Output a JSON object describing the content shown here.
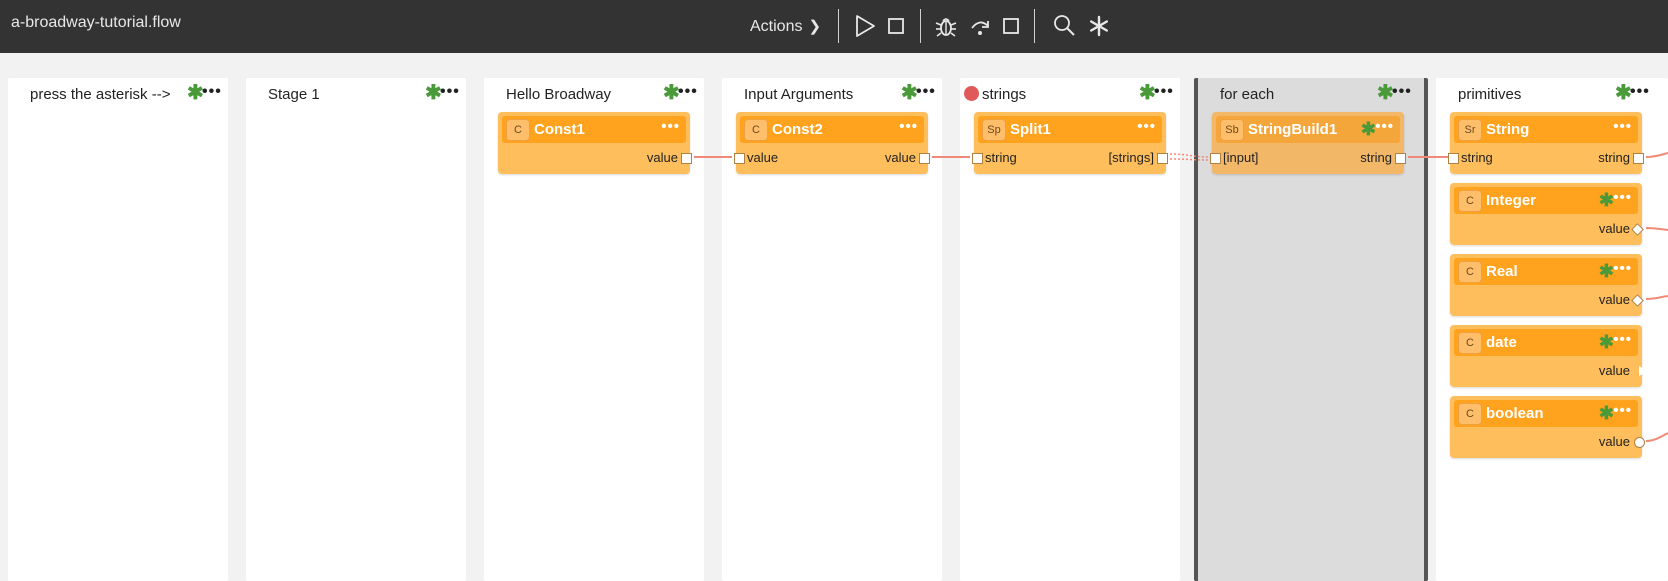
{
  "topbar": {
    "filename": "a-broadway-tutorial.flow",
    "actions_label": "Actions",
    "icons": [
      "play-icon",
      "stop-icon",
      "debug-bug-icon",
      "step-over-icon",
      "debug-stop-icon",
      "search-icon",
      "asterisk-icon"
    ]
  },
  "stages": [
    {
      "title": "press the asterisk -->"
    },
    {
      "title": "Stage 1"
    },
    {
      "title": "Hello Broadway"
    },
    {
      "title": "Input Arguments"
    },
    {
      "title": "strings"
    },
    {
      "title": "for each"
    },
    {
      "title": "primitives"
    }
  ],
  "nodes": [
    {
      "type": "C",
      "name": "Const1",
      "ports": {
        "out": "value"
      }
    },
    {
      "type": "C",
      "name": "Const2",
      "ports": {
        "in": "value",
        "out": "value"
      }
    },
    {
      "type": "Sp",
      "name": "Split1",
      "ports": {
        "in": "string",
        "out": "[strings]"
      }
    },
    {
      "type": "Sb",
      "name": "StringBuild1",
      "ports": {
        "in": "[input]",
        "out": "string"
      }
    },
    {
      "type": "Sr",
      "name": "String",
      "ports": {
        "in": "string",
        "out": "string"
      }
    },
    {
      "type": "C",
      "name": "Integer",
      "ports": {
        "out": "value"
      }
    },
    {
      "type": "C",
      "name": "Real",
      "ports": {
        "out": "value"
      }
    },
    {
      "type": "C",
      "name": "date",
      "ports": {
        "out": "value"
      }
    },
    {
      "type": "C",
      "name": "boolean",
      "ports": {
        "out": "value"
      }
    }
  ],
  "colors": {
    "topbar": "#333333",
    "node_body": "#ffbe5c",
    "node_header": "#ffa21e",
    "asterisk": "#4a9a3a",
    "wire": "#f08a78",
    "error_dot": "#e05a5a"
  }
}
